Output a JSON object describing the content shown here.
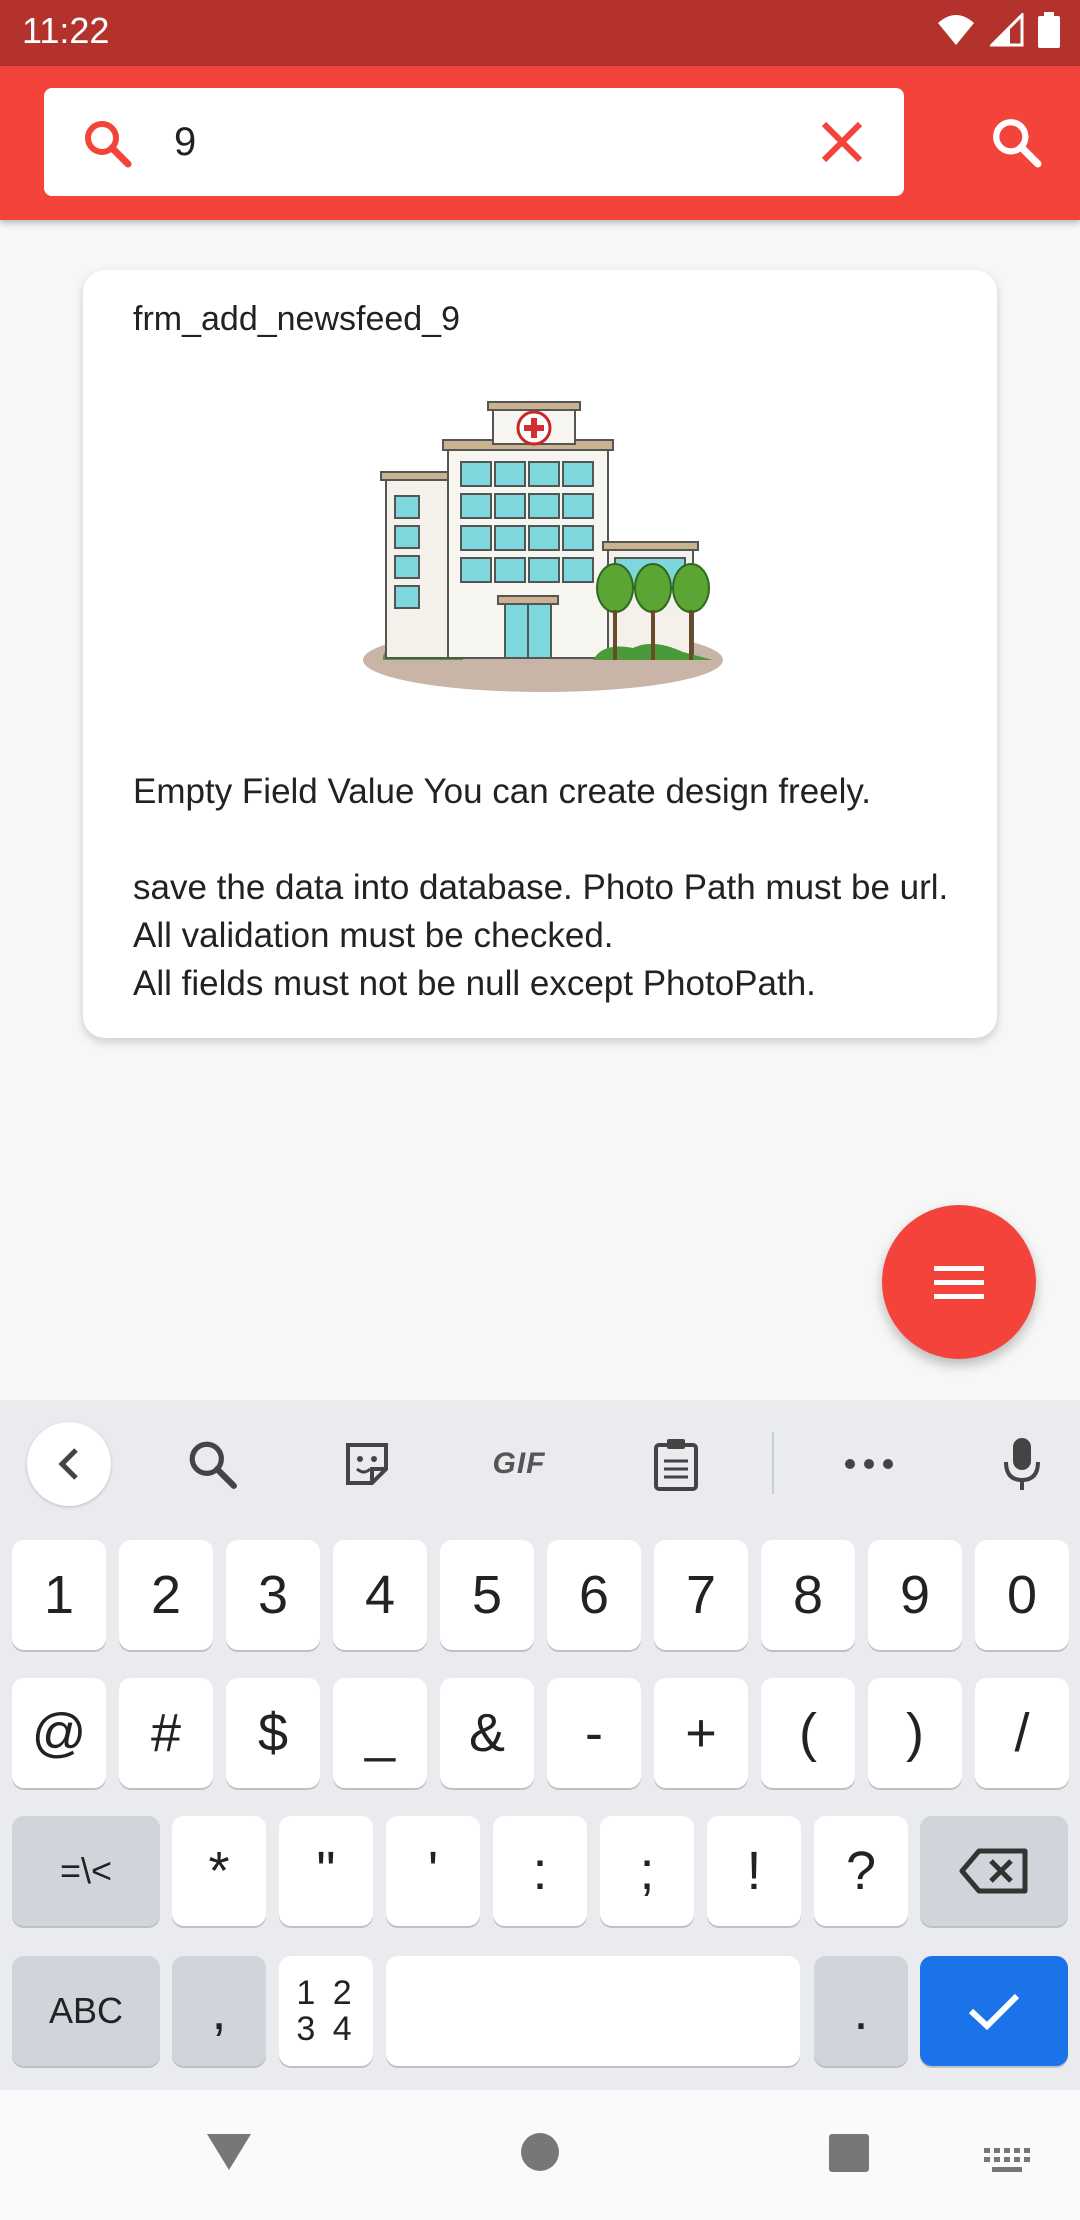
{
  "status_bar": {
    "time": "11:22"
  },
  "search": {
    "value": "9",
    "placeholder": ""
  },
  "card": {
    "title": "frm_add_newsfeed_9",
    "description": "Empty Field Value You can create design freely.\n\nsave the data into database. Photo Path must be url. All validation must be checked.\nAll fields must not be null except PhotoPath."
  },
  "keyboard": {
    "toolbar": {
      "gif_label": "GIF"
    },
    "row1": [
      "1",
      "2",
      "3",
      "4",
      "5",
      "6",
      "7",
      "8",
      "9",
      "0"
    ],
    "row2": [
      "@",
      "#",
      "$",
      "_",
      "&",
      "-",
      "+",
      "(",
      ")",
      "/"
    ],
    "row3": [
      "=\\<",
      "*",
      "\"",
      "'",
      ":",
      ";",
      "!",
      "?"
    ],
    "row4": {
      "abc": "ABC",
      "comma": ",",
      "numpad_top": "1 2",
      "numpad_bottom": "3 4",
      "period": "."
    }
  },
  "colors": {
    "status_bar": "#b3332c",
    "primary": "#f4433b",
    "keyboard_bg": "#e9ebef",
    "enter_key": "#1a73e8"
  },
  "icons": {
    "status": [
      "wifi-icon",
      "cellular-icon",
      "battery-icon"
    ],
    "search_lead": "search-icon",
    "clear": "close-icon",
    "app_bar_action": "search-icon",
    "fab": "menu-icon",
    "keyboard_toolbar": [
      "chevron-left-icon",
      "search-icon",
      "sticker-icon",
      "gif-icon",
      "clipboard-icon",
      "more-icon",
      "mic-icon"
    ],
    "backspace": "backspace-icon",
    "enter": "check-icon",
    "nav": [
      "back-icon",
      "home-icon",
      "recents-icon",
      "keyboard-icon"
    ]
  }
}
